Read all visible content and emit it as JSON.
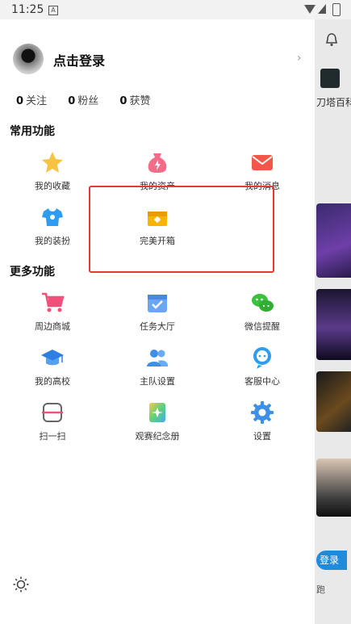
{
  "status_bar": {
    "time": "11:25",
    "a_icon": "A"
  },
  "background": {
    "dota_label": "刀塔百科",
    "login_label": "登录",
    "bottom_label": "跑"
  },
  "profile": {
    "login_text": "点击登录",
    "chevron": "›"
  },
  "stats": [
    {
      "count": "0",
      "label": "关注"
    },
    {
      "count": "0",
      "label": "粉丝"
    },
    {
      "count": "0",
      "label": "获赞"
    }
  ],
  "sections": {
    "common": "常用功能",
    "more": "更多功能"
  },
  "common_items": [
    {
      "label": "我的收藏",
      "icon": "star-icon"
    },
    {
      "label": "我的资产",
      "icon": "money-bag-icon"
    },
    {
      "label": "我的消息",
      "icon": "mail-icon"
    },
    {
      "label": "我的装扮",
      "icon": "shirt-icon"
    },
    {
      "label": "完美开箱",
      "icon": "treasure-box-icon"
    }
  ],
  "more_items": [
    {
      "label": "周边商城",
      "icon": "cart-icon"
    },
    {
      "label": "任务大厅",
      "icon": "calendar-check-icon"
    },
    {
      "label": "微信提醒",
      "icon": "wechat-icon"
    },
    {
      "label": "我的高校",
      "icon": "graduation-cap-icon"
    },
    {
      "label": "主队设置",
      "icon": "team-icon"
    },
    {
      "label": "客服中心",
      "icon": "customer-service-icon"
    },
    {
      "label": "扫一扫",
      "icon": "scan-icon"
    },
    {
      "label": "观赛纪念册",
      "icon": "album-icon"
    },
    {
      "label": "设置",
      "icon": "gear-icon"
    }
  ]
}
